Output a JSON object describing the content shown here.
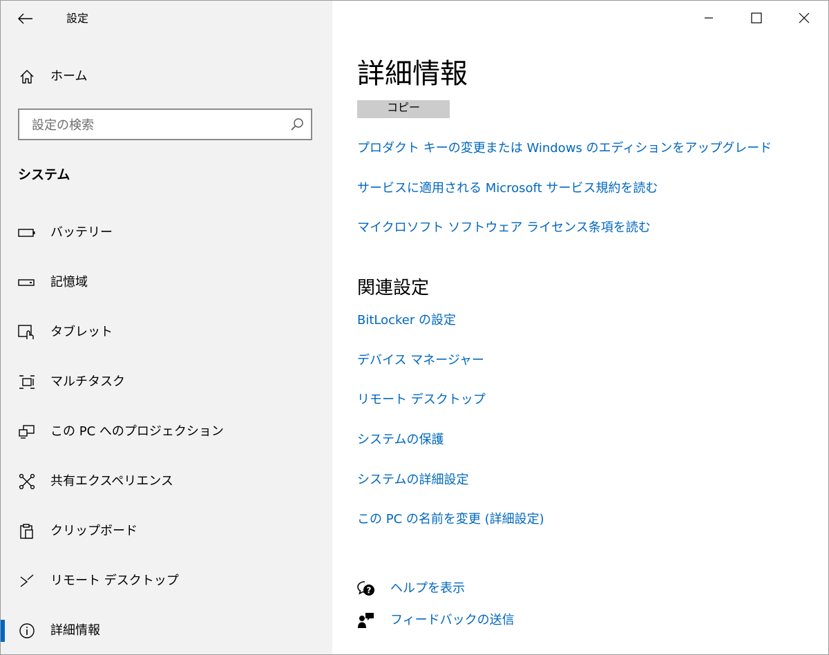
{
  "window": {
    "title": "設定"
  },
  "sidebar": {
    "home_label": "ホーム",
    "search": {
      "placeholder": "設定の検索",
      "value": ""
    },
    "section_title": "システム",
    "items": [
      {
        "label": "バッテリー",
        "icon": "battery-icon"
      },
      {
        "label": "記憶域",
        "icon": "storage-icon"
      },
      {
        "label": "タブレット",
        "icon": "tablet-icon"
      },
      {
        "label": "マルチタスク",
        "icon": "multitask-icon"
      },
      {
        "label": "この PC へのプロジェクション",
        "icon": "projection-icon"
      },
      {
        "label": "共有エクスペリエンス",
        "icon": "shared-experience-icon"
      },
      {
        "label": "クリップボード",
        "icon": "clipboard-icon"
      },
      {
        "label": "リモート デスクトップ",
        "icon": "remote-desktop-icon"
      },
      {
        "label": "詳細情報",
        "icon": "info-icon",
        "active": true
      }
    ]
  },
  "content": {
    "title": "詳細情報",
    "copy_button_label": "コピー",
    "links": [
      "プロダクト キーの変更または Windows のエディションをアップグレード",
      "サービスに適用される Microsoft サービス規約を読む",
      "マイクロソフト ソフトウェア ライセンス条項を読む"
    ],
    "related_title": "関連設定",
    "related_links": [
      "BitLocker の設定",
      "デバイス マネージャー",
      "リモート デスクトップ",
      "システムの保護",
      "システムの詳細設定",
      "この PC の名前を変更 (詳細設定)"
    ],
    "help_label": "ヘルプを表示",
    "feedback_label": "フィードバックの送信"
  },
  "colors": {
    "accent": "#0067c0",
    "sidebar_bg": "#f2f2f2",
    "copy_button_bg": "#cccccc"
  }
}
